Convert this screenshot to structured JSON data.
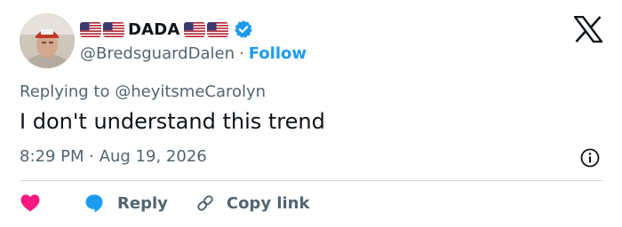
{
  "author": {
    "display_name": "DADA",
    "handle": "@BredsguardDalen",
    "verified": true,
    "follow_label": "Follow",
    "separator": "·",
    "name_flags": [
      "us-flag",
      "us-flag",
      "us-flag",
      "us-flag"
    ]
  },
  "tweet": {
    "reply_prefix": "Replying to",
    "reply_mention": "@heyitsmeCarolyn",
    "text": "I don't understand this trend",
    "timestamp": "8:29 PM · Aug 19, 2026"
  },
  "actions": {
    "like_icon": "heart-icon",
    "reply_label": "Reply",
    "reply_icon": "speech-bubble-icon",
    "copy_label": "Copy link",
    "copy_icon": "link-icon"
  },
  "colors": {
    "accent": "#1d9bf0",
    "text_primary": "#0f1419",
    "text_secondary": "#536471",
    "like": "#f91880",
    "divider": "#cfd9de"
  },
  "icons": {
    "logo": "x-logo-icon",
    "info": "info-icon"
  }
}
